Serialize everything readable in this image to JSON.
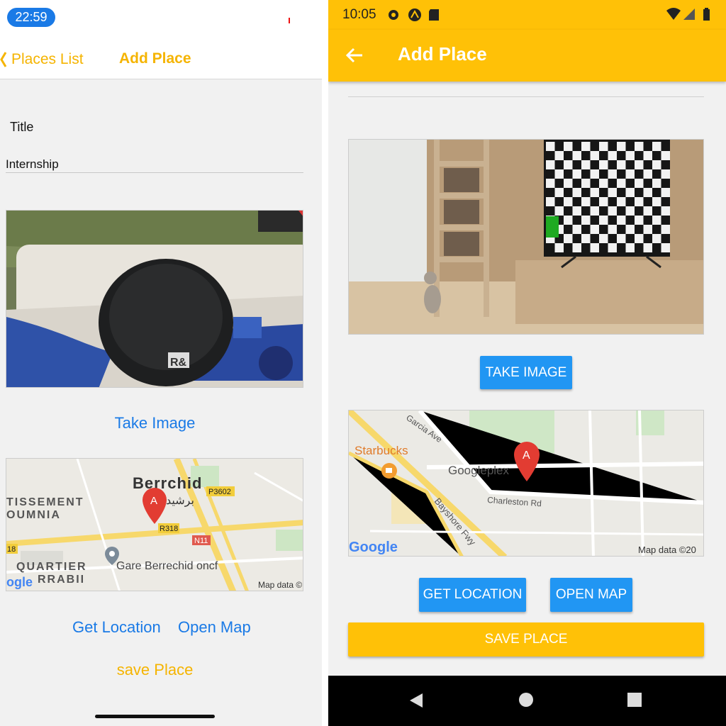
{
  "ios": {
    "status": {
      "time": "22:59"
    },
    "nav": {
      "back_label": "Places List",
      "title": "Add Place"
    },
    "form": {
      "title_label": "Title",
      "title_value": "Internship"
    },
    "photo": {
      "logo_text": "R&"
    },
    "take_image_label": "Take Image",
    "map": {
      "city": "Berrchid",
      "city_arabic": "برشيد",
      "district_1a": "TISSEMENT",
      "district_1b": "OUMNIA",
      "district_2a": "QUARTIER",
      "district_2b": "RRABII",
      "road_p": "P3602",
      "road_r": "R318",
      "road_n": "N11",
      "road_18": "18",
      "station": "Gare Berrechid oncf",
      "google_logo": "ogle",
      "attribution": "Map data ©",
      "marker_letter": "A"
    },
    "actions": {
      "get_location": "Get Location",
      "open_map": "Open Map",
      "save": "save Place"
    }
  },
  "android": {
    "status": {
      "time": "10:05"
    },
    "appbar": {
      "title": "Add Place"
    },
    "buttons": {
      "take_image": "TAKE IMAGE",
      "get_location": "GET LOCATION",
      "open_map": "OPEN MAP",
      "save": "SAVE PLACE"
    },
    "map": {
      "cafe": "Starbucks",
      "place": "Googleplex",
      "road_1": "Charleston Rd",
      "road_2": "Garcia Ave",
      "road_3": "Bayshore Fwy",
      "google_logo": "Google",
      "attribution": "Map data ©20",
      "marker_letter": "A"
    }
  },
  "colors": {
    "accent_yellow": "#ffc107",
    "ios_yellow": "#f5b400",
    "ios_blue": "#1a7ae6",
    "material_blue": "#2196f3"
  }
}
